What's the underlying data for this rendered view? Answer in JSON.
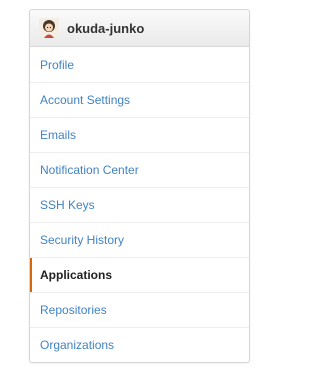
{
  "header": {
    "username": "okuda-junko",
    "avatar_icon": "user-avatar"
  },
  "menu": {
    "items": [
      {
        "label": "Profile",
        "selected": false
      },
      {
        "label": "Account Settings",
        "selected": false
      },
      {
        "label": "Emails",
        "selected": false
      },
      {
        "label": "Notification Center",
        "selected": false
      },
      {
        "label": "SSH Keys",
        "selected": false
      },
      {
        "label": "Security History",
        "selected": false
      },
      {
        "label": "Applications",
        "selected": true
      },
      {
        "label": "Repositories",
        "selected": false
      },
      {
        "label": "Organizations",
        "selected": false
      }
    ]
  },
  "colors": {
    "link": "#4183c4",
    "selected_text": "#222222",
    "selected_accent": "#d26911"
  }
}
